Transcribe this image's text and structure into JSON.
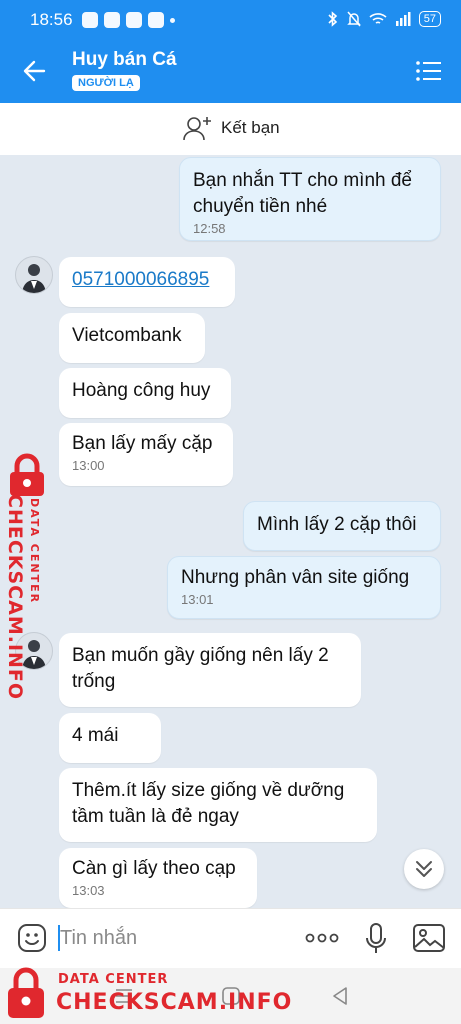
{
  "status": {
    "time": "18:56",
    "battery": "57"
  },
  "header": {
    "title": "Huy bán Cá",
    "badge": "NGƯỜI LẠ"
  },
  "add_friend": {
    "label": "Kết bạn"
  },
  "messages": [
    {
      "side": "out",
      "text": "Bạn nhắn TT cho mình để chuyển tiền nhé",
      "time": "12:58"
    },
    {
      "side": "in",
      "text": "0571000066895",
      "link": true
    },
    {
      "side": "in",
      "text": "Vietcombank"
    },
    {
      "side": "in",
      "text": "Hoàng công huy"
    },
    {
      "side": "in",
      "text": "Bạn lấy mấy cặp",
      "time": "13:00"
    },
    {
      "side": "out",
      "text": "Mình lấy 2 cặp thôi"
    },
    {
      "side": "out",
      "text": "Nhưng phân vân site giống",
      "time": "13:01"
    },
    {
      "side": "in",
      "text": "Bạn muốn gầy giống nên lấy 2 trống"
    },
    {
      "side": "in",
      "text": "4 mái"
    },
    {
      "side": "in",
      "text": "Thêm.ít lấy size giống về dưỡng tầm tuần là đẻ ngay"
    },
    {
      "side": "in",
      "text": "Càn gì lấy theo cạp",
      "time": "13:03"
    }
  ],
  "input": {
    "placeholder": "Tin nhắn"
  },
  "watermark": {
    "label": "DATA CENTER",
    "name": "CHECKSCAM.INFO"
  },
  "colors": {
    "accent": "#1f8ef0",
    "outgoing_bubble": "#e4f2fc",
    "background": "#e2e9f1",
    "watermark": "#e0282e"
  }
}
